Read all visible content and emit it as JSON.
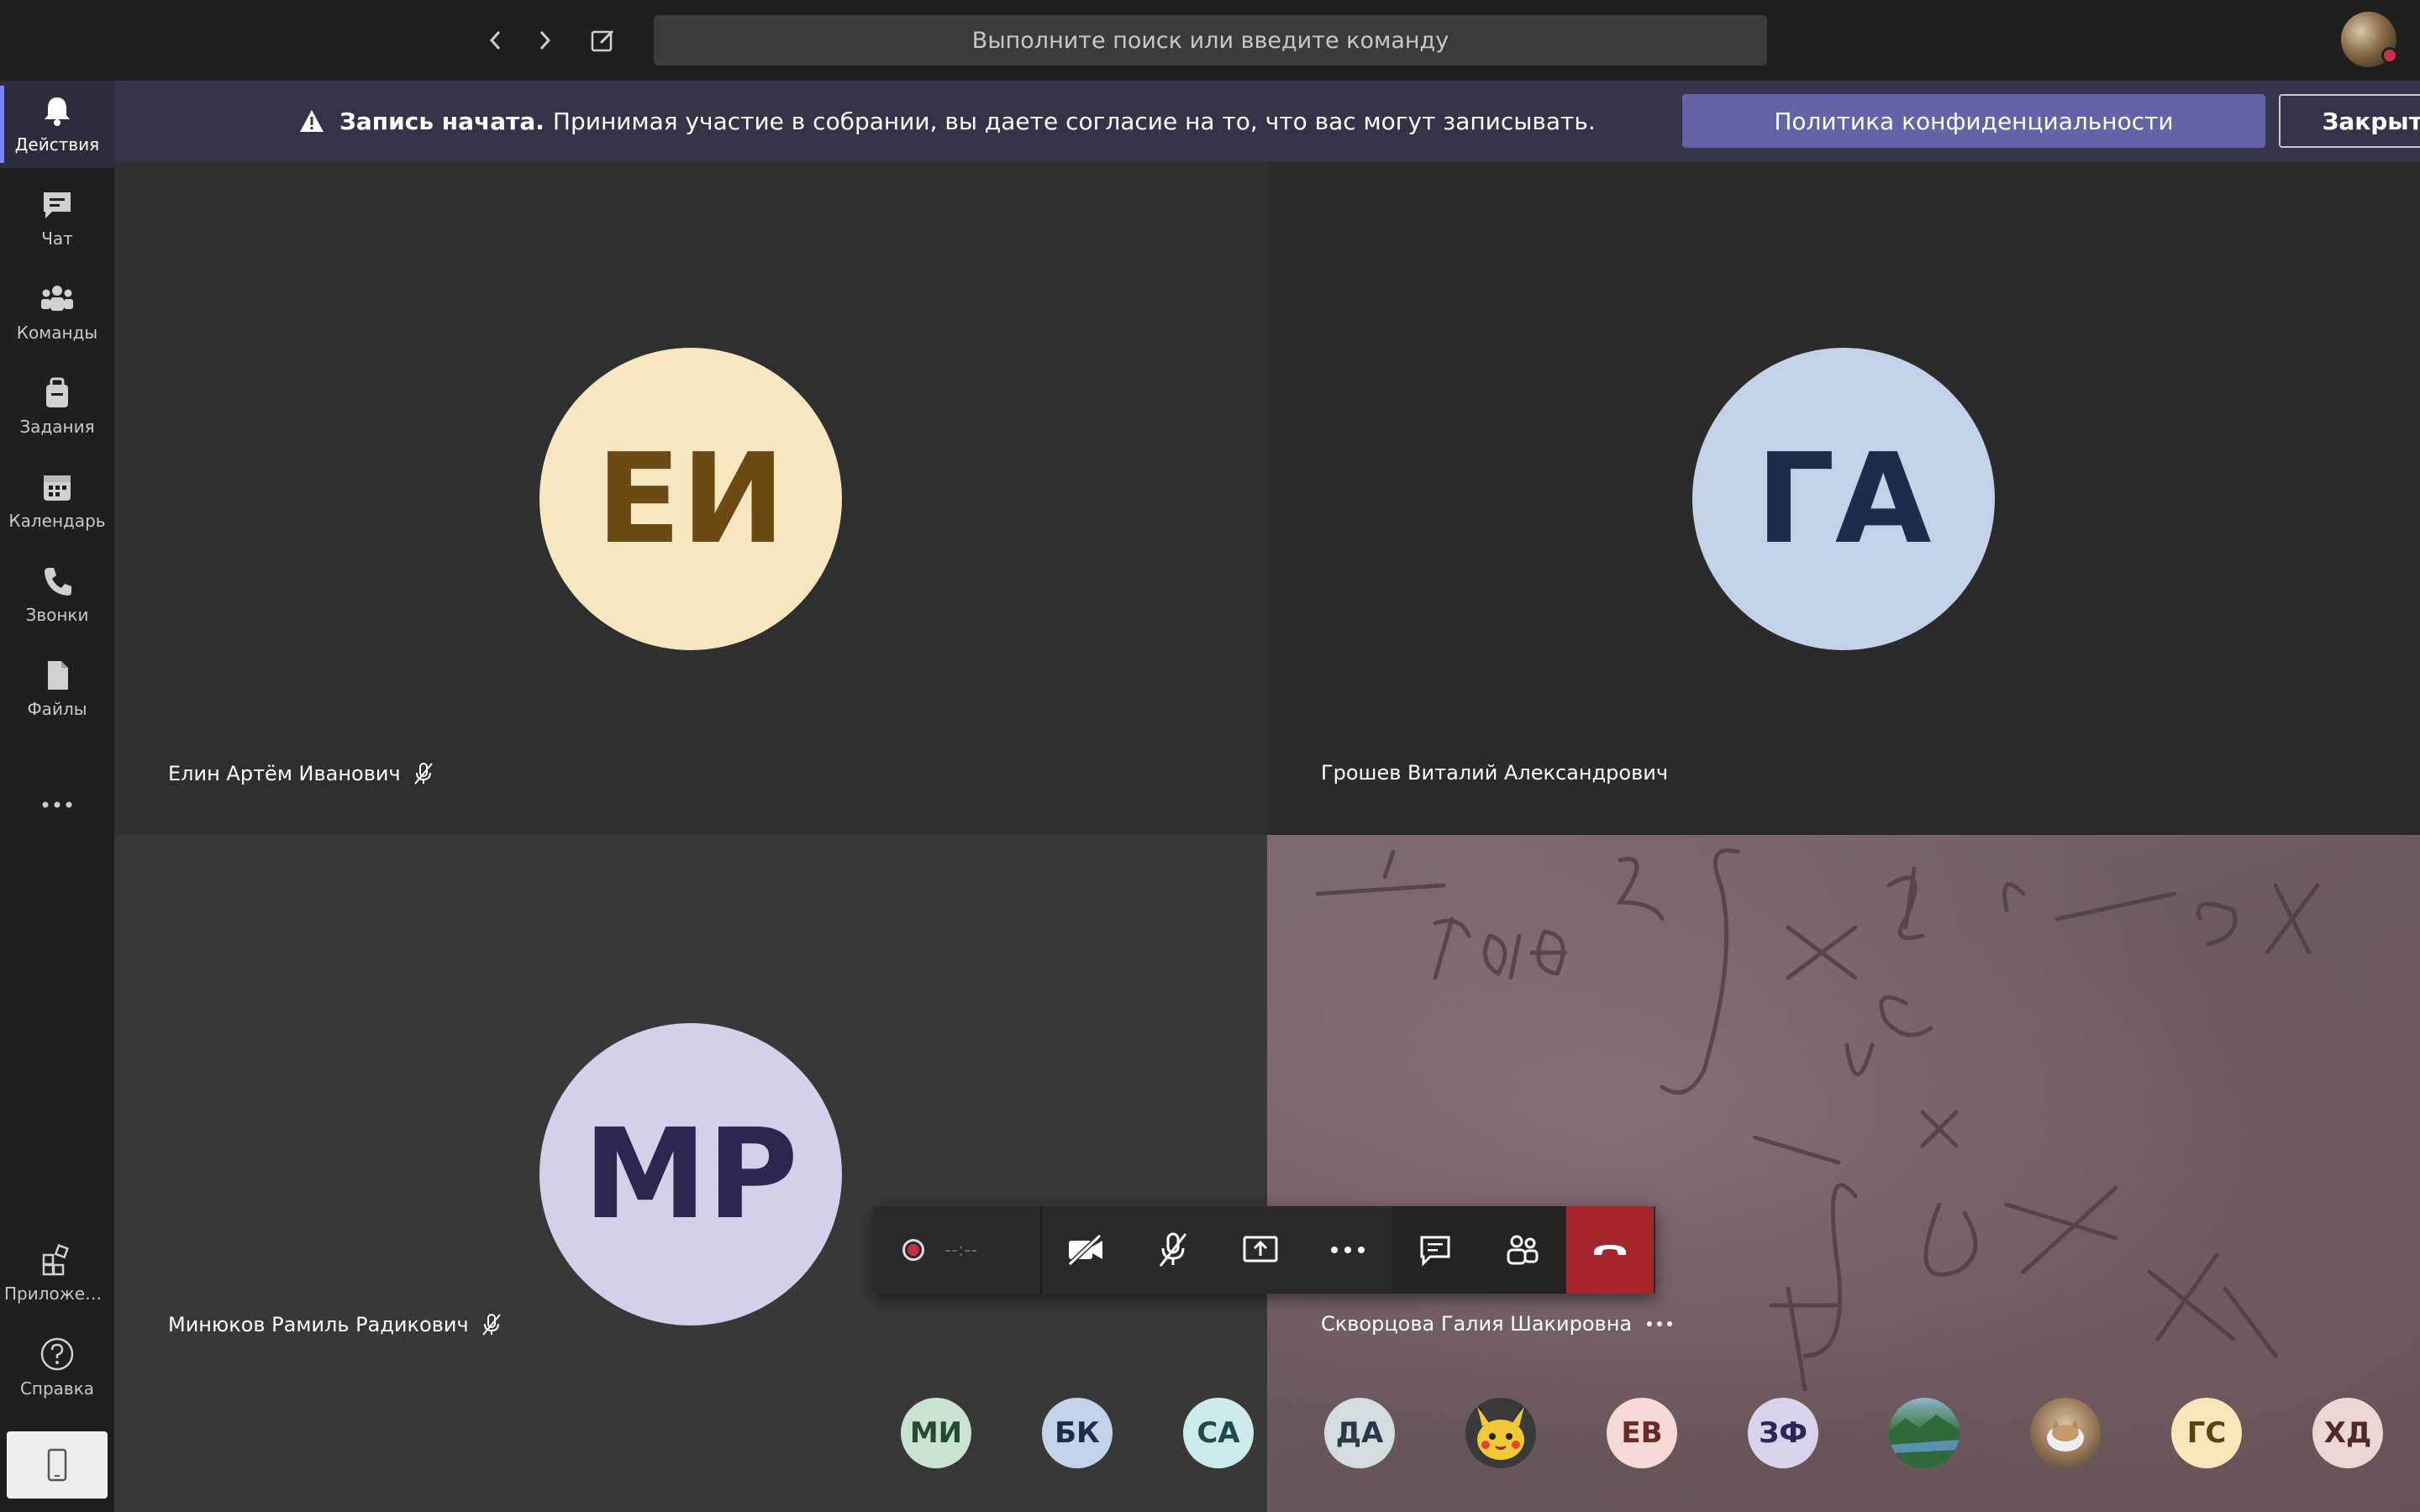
{
  "topbar": {
    "search_placeholder": "Выполните поиск или введите команду"
  },
  "rail": {
    "items": [
      {
        "label": "Действия",
        "icon": "bell-icon"
      },
      {
        "label": "Чат",
        "icon": "chat-icon"
      },
      {
        "label": "Команды",
        "icon": "teams-icon"
      },
      {
        "label": "Задания",
        "icon": "assignments-icon"
      },
      {
        "label": "Календарь",
        "icon": "calendar-icon"
      },
      {
        "label": "Звонки",
        "icon": "phone-icon"
      },
      {
        "label": "Файлы",
        "icon": "files-icon"
      }
    ],
    "apps_label": "Приложен…",
    "help_label": "Справка"
  },
  "banner": {
    "title": "Запись начата.",
    "message": "Принимая участие в собрании, вы даете согласие на то, что вас могут записывать.",
    "privacy_button": "Политика конфиденциальности",
    "close_button": "Закрыть"
  },
  "participants": [
    {
      "initials": "ЕИ",
      "name": "Елин Артём Иванович",
      "muted": true,
      "bg": "#f8e6c0",
      "fg": "#6b4a14"
    },
    {
      "initials": "ГА",
      "name": "Грошев Виталий Александрович",
      "muted": false,
      "bg": "#c3d2e8",
      "fg": "#1d2c4a"
    },
    {
      "initials": "МР",
      "name": "Минюков Рамиль Радикович",
      "muted": true,
      "bg": "#d3d1ea",
      "fg": "#2a2750"
    },
    {
      "initials": "",
      "name": "Скворцова Галия Шакировна",
      "muted": false,
      "video": true
    }
  ],
  "controls": {
    "timer": "--:--"
  },
  "strip": [
    {
      "initials": "МИ",
      "bg": "#c9e2d2",
      "fg": "#244a32"
    },
    {
      "initials": "БК",
      "bg": "#c3d2e8",
      "fg": "#1d2c4a"
    },
    {
      "initials": "СА",
      "bg": "#cdeaea",
      "fg": "#1e4a4a"
    },
    {
      "initials": "ДА",
      "bg": "#d4dce0",
      "fg": "#2a3a44"
    },
    {
      "initials": "",
      "photo": "pikachu",
      "bg": "#f0c935"
    },
    {
      "initials": "ЕВ",
      "bg": "#f6d8d6",
      "fg": "#6a2a26"
    },
    {
      "initials": "ЗФ",
      "bg": "#d8d2ec",
      "fg": "#2e2658"
    },
    {
      "initials": "",
      "photo": "landscape",
      "bg": "#3f7a4a"
    },
    {
      "initials": "",
      "photo": "cat",
      "bg": "#8a7560"
    },
    {
      "initials": "ГС",
      "bg": "#f8e6b8",
      "fg": "#5c4410"
    },
    {
      "initials": "ХД",
      "bg": "#ead6d2",
      "fg": "#4a2c28"
    }
  ]
}
